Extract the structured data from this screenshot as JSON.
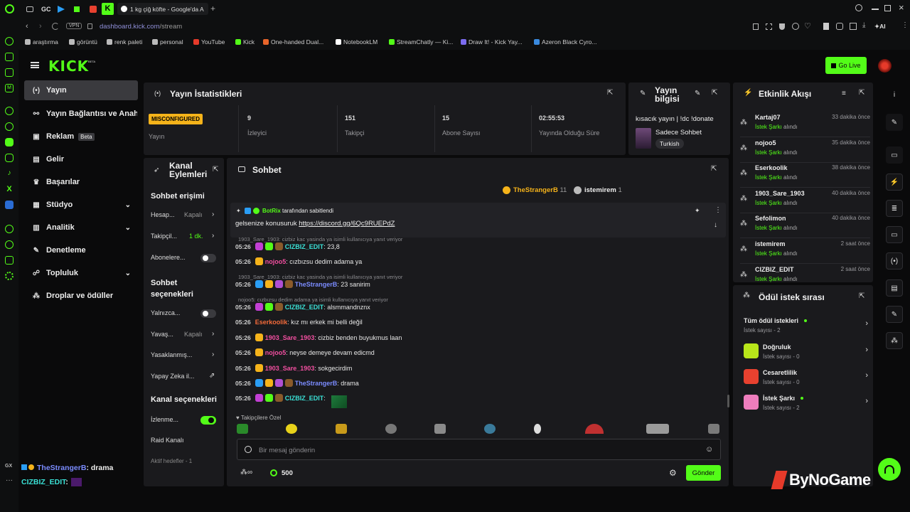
{
  "browser": {
    "tab_title": "1 kg çiğ köfte - Google'da A",
    "url_host": "dashboard.kick.com",
    "url_path": "/stream",
    "vpn": "VPN",
    "tab_gc": "GC",
    "ai_label": "AI",
    "bookmarks": [
      "araştırma",
      "görüntü",
      "renk paleti",
      "personal",
      "YouTube",
      "Kick",
      "One-handed Dual...",
      "NotebookLM",
      "StreamChatly — Ki...",
      "Draw It! - Kick Yay...",
      "Azeron Black Cyro..."
    ]
  },
  "brand": {
    "logo": "KICK",
    "logo_beta": "BETA",
    "go_live": "Go Live"
  },
  "sidebar": {
    "items": [
      {
        "label": "Yayın",
        "icon": "broadcast-icon"
      },
      {
        "label": "Yayın Bağlantısı ve Anahtar",
        "icon": "link-icon"
      },
      {
        "label": "Reklam",
        "icon": "ad-icon",
        "badge": "Beta"
      },
      {
        "label": "Gelir",
        "icon": "revenue-icon"
      },
      {
        "label": "Başarılar",
        "icon": "trophy-icon"
      },
      {
        "label": "Stüdyo",
        "icon": "studio-icon"
      },
      {
        "label": "Analitik",
        "icon": "chart-icon"
      },
      {
        "label": "Denetleme",
        "icon": "wrench-icon"
      },
      {
        "label": "Topluluk",
        "icon": "community-icon"
      },
      {
        "label": "Droplar ve ödüller",
        "icon": "drop-icon"
      }
    ]
  },
  "stats": {
    "title": "Yayın İstatistikleri",
    "status_badge": "MISCONFIGURED",
    "status_label": "Yayın",
    "items": [
      {
        "value": "9",
        "label": "İzleyici"
      },
      {
        "value": "151",
        "label": "Takipçi"
      },
      {
        "value": "15",
        "label": "Abone Sayısı"
      },
      {
        "value": "02:55:53",
        "label": "Yayında Olduğu Süre"
      }
    ]
  },
  "info": {
    "title": "Yayın bilgisi",
    "stream_title": "kısacık yayın | !dc !donate",
    "category": "Sadece Sohbet",
    "language": "Turkish"
  },
  "events": {
    "title": "Etkinlik Akışı",
    "items": [
      {
        "user": "Kartaj07",
        "type": "İstek Şarkı",
        "action": "alındı",
        "time": "33 dakika önce"
      },
      {
        "user": "nojoo5",
        "type": "İstek Şarkı",
        "action": "alındı",
        "time": "35 dakika önce"
      },
      {
        "user": "Eserkoolik",
        "type": "İstek Şarkı",
        "action": "alındı",
        "time": "38 dakika önce"
      },
      {
        "user": "1903_Sare_1903",
        "type": "İstek Şarkı",
        "action": "alındı",
        "time": "40 dakika önce"
      },
      {
        "user": "Sefolimon",
        "type": "İstek Şarkı",
        "action": "alındı",
        "time": "40 dakika önce"
      },
      {
        "user": "istemirem",
        "type": "İstek Şarkı",
        "action": "alındı",
        "time": "2 saat önce"
      },
      {
        "user": "CIZBIZ_EDIT",
        "type": "İstek Şarkı",
        "action": "alındı",
        "time": "2 saat önce"
      }
    ]
  },
  "rewards": {
    "title": "Ödül istek sırası",
    "all_label": "Tüm ödül istekleri",
    "all_count": "İstek sayısı - 2",
    "items": [
      {
        "name": "Doğruluk",
        "count": "İstek sayısı - 0",
        "color": "#b8e61a"
      },
      {
        "name": "Cesaretlilik",
        "count": "İstek sayısı - 0",
        "color": "#e8412f"
      },
      {
        "name": "İstek Şarkı",
        "count": "İstek sayısı - 2",
        "color": "#ee7dbd"
      }
    ]
  },
  "actions": {
    "title": "Kanal Eylemleri",
    "chat_access": "Sohbet erişimi",
    "rows1": [
      {
        "label": "Hesap...",
        "value": "Kapalı"
      },
      {
        "label": "Takipçil...",
        "value": "1 dk."
      },
      {
        "label": "Abonelere...",
        "value": ""
      }
    ],
    "chat_options": "Sohbet seçenekleri",
    "rows2": [
      {
        "label": "Yalnızca...",
        "value": ""
      },
      {
        "label": "Yavaş...",
        "value": "Kapalı"
      },
      {
        "label": "Yasaklanmış...",
        "value": ""
      },
      {
        "label": "Yapay Zeka il...",
        "value": ""
      }
    ],
    "channel_options": "Kanal seçenekleri",
    "watch_label": "İzlenme...",
    "raid_label": "Raid Kanalı",
    "active_goals": "Aktif hedefler - 1"
  },
  "chat": {
    "title": "Sohbet",
    "top_users": [
      {
        "name": "TheStrangerB",
        "count": "11"
      },
      {
        "name": "istemirem",
        "count": "1"
      }
    ],
    "pinned_by": "BotRix",
    "pinned_suffix": "tarafından sabitlendi",
    "pinned_text": "gelsenize konusuruk",
    "pinned_link": "https://discord.gg/6Qc9RUEPdZ",
    "messages": [
      {
        "reply": "1903_Sare_1903: cizbiz kac yasinda ya isimli kullanıcıya yanıt veriyor",
        "time": "05:26",
        "user": "CIZBIZ_EDIT",
        "color": "#3ae0d5",
        "text": ": 23,8"
      },
      {
        "reply": "",
        "time": "05:26",
        "user": "nojoo5",
        "color": "#f24fa0",
        "text": ": cızbızsu dedim adama ya"
      },
      {
        "reply": "1903_Sare_1903: cizbiz kac yasinda ya isimli kullanıcıya yanıt veriyor",
        "time": "05:26",
        "user": "TheStrangerB",
        "color": "#7b8cff",
        "text": ": 23 sanirim"
      },
      {
        "reply": "nojoo5: cızbızsu dedim adama ya isimli kullanıcıya yanıt veriyor",
        "time": "05:26",
        "user": "CIZBIZ_EDIT",
        "color": "#3ae0d5",
        "text": ": alsmmandnznx"
      },
      {
        "reply": "",
        "time": "05:26",
        "user": "Eserkoolik",
        "color": "#f56b3a",
        "text": ": kız mı erkek mi belli değil"
      },
      {
        "reply": "",
        "time": "05:26",
        "user": "1903_Sare_1903",
        "color": "#f24fa0",
        "text": ": cizbiz benden buyukmus laan"
      },
      {
        "reply": "",
        "time": "05:26",
        "user": "nojoo5",
        "color": "#f24fa0",
        "text": ": neyse demeye devam edicmd"
      },
      {
        "reply": "",
        "time": "05:26",
        "user": "1903_Sare_1903",
        "color": "#f24fa0",
        "text": ": sokgecirdim"
      },
      {
        "reply": "",
        "time": "05:26",
        "user": "TheStrangerB",
        "color": "#7b8cff",
        "text": ": drama"
      },
      {
        "reply": "",
        "time": "05:26",
        "user": "CIZBIZ_EDIT",
        "color": "#3ae0d5",
        "text": ":"
      }
    ],
    "followers_label": "Takipçilere Özel",
    "input_placeholder": "Bir mesaj gönderin",
    "points": "500",
    "send": "Gönder"
  },
  "overlay": {
    "line1_user": "TheStrangerB",
    "line1_text": ": drama",
    "line2_user": "CIZBIZ_EDIT",
    "line2_text": ":",
    "watermark": "ByNoGame"
  }
}
